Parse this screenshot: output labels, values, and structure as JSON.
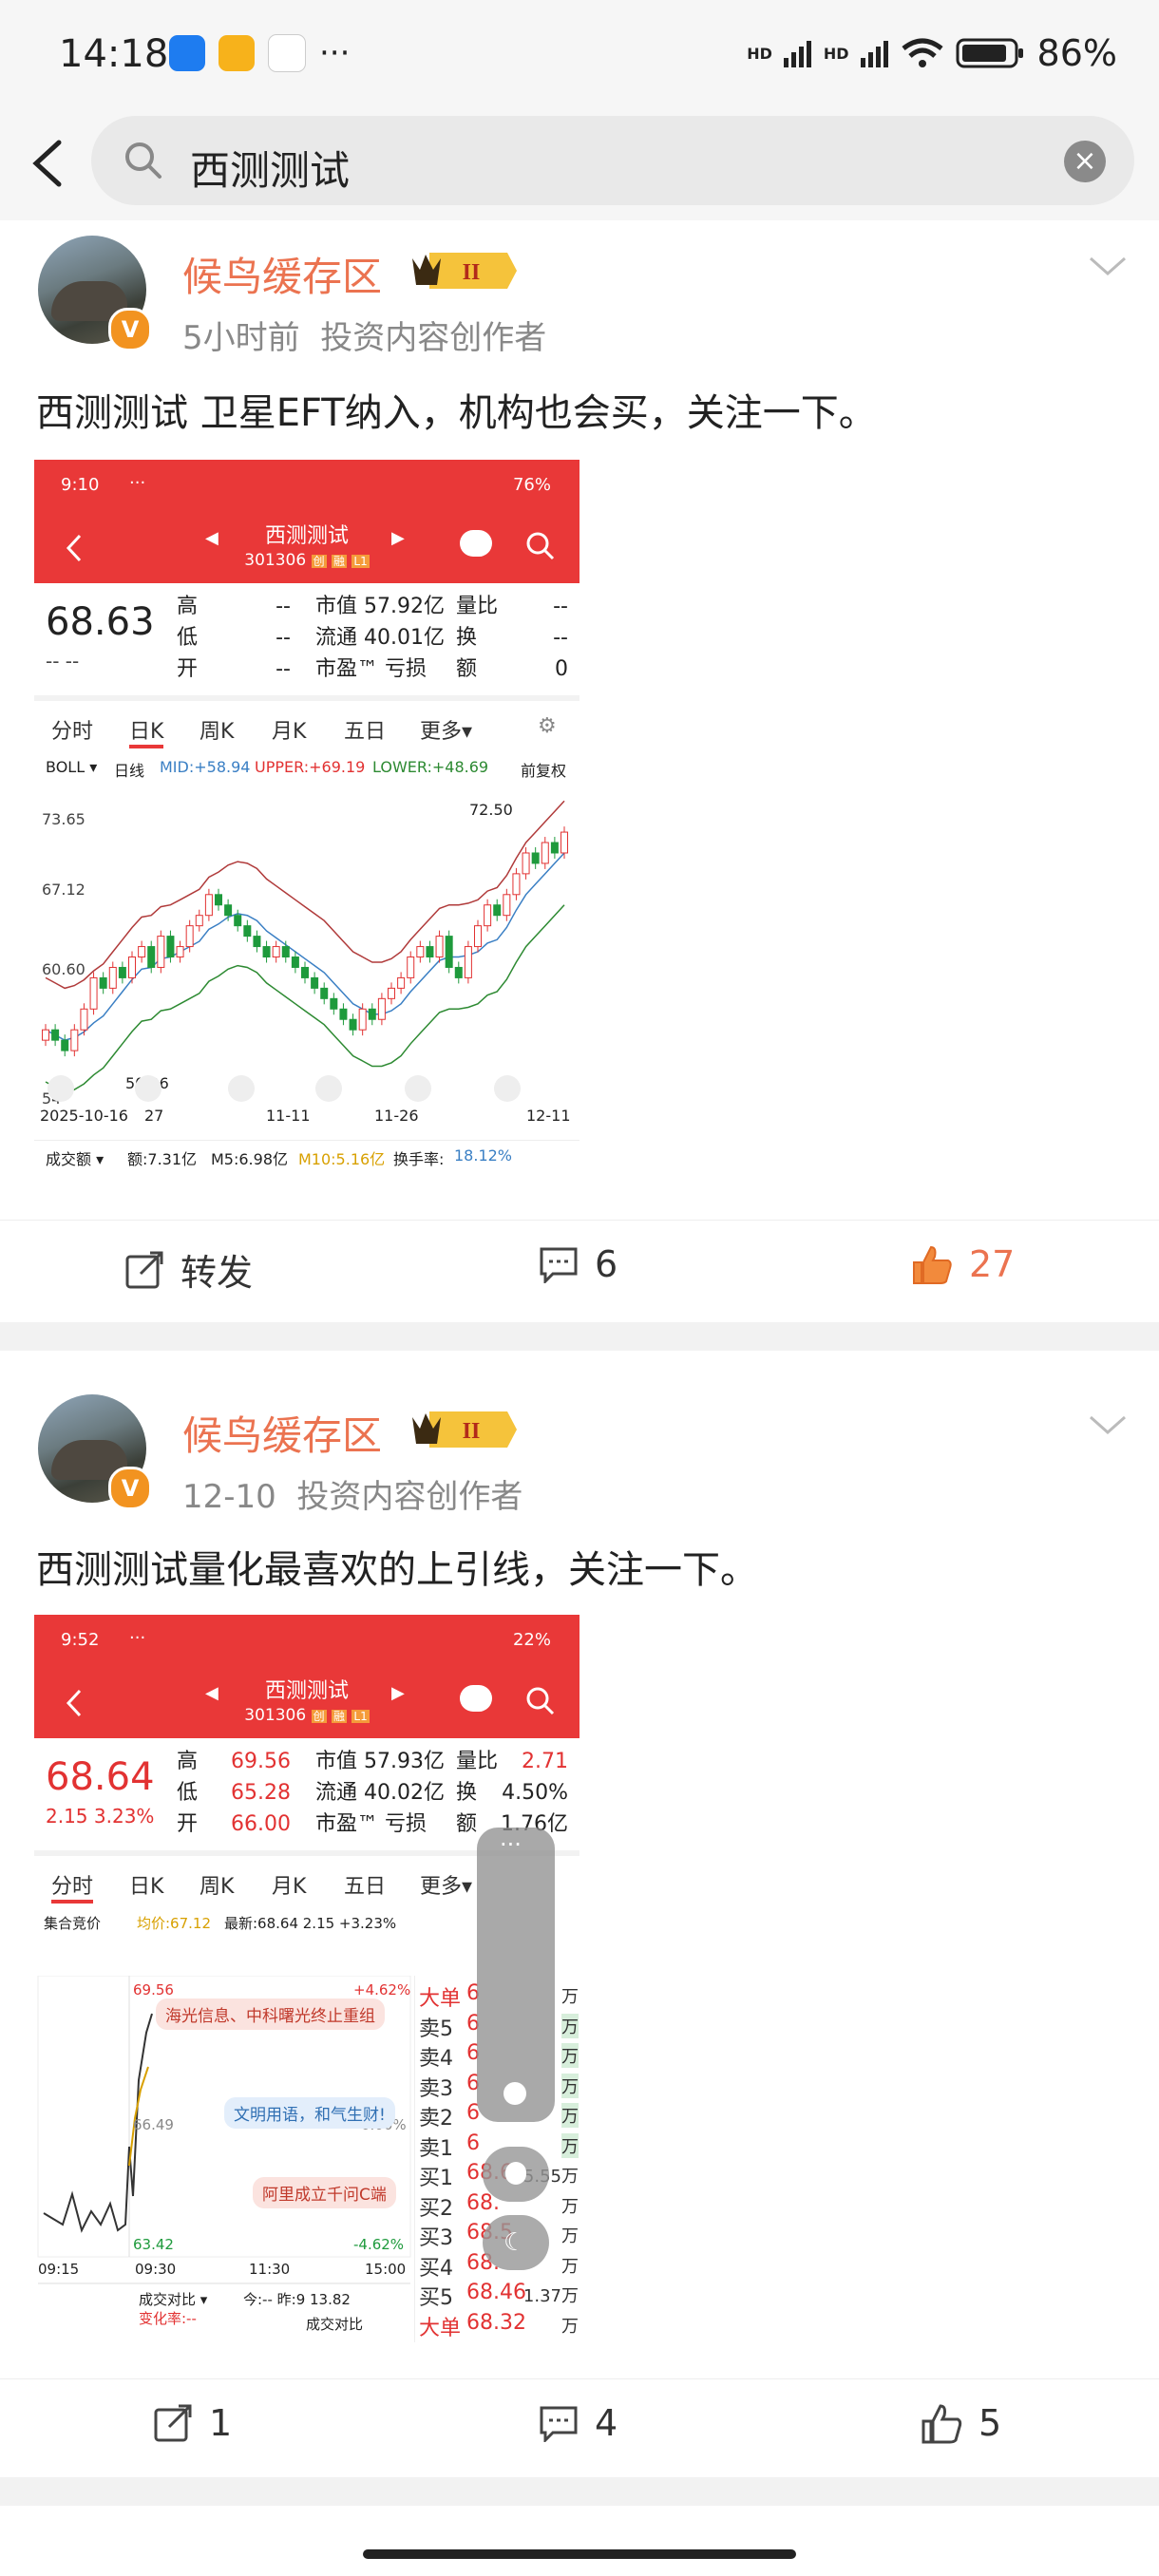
{
  "status_bar": {
    "time": "14:18",
    "dots": "···",
    "network_1": "HD",
    "network_2": "HD",
    "battery": "86%"
  },
  "search": {
    "query": "西测测试"
  },
  "posts": [
    {
      "author": "候鸟缓存区",
      "level": "II",
      "time": "5小时前",
      "role": "投资内容创作者",
      "text": "西测测试 卫星EFT纳入，机构也会买，关注一下。",
      "screenshot": {
        "status_time": "9:10",
        "status_dots": "···",
        "battery": "76%",
        "title": "西测测试",
        "code": "301306",
        "badges": [
          "创",
          "融",
          "L1"
        ],
        "price": "68.63",
        "change": "-- --",
        "quote_rows": [
          {
            "k1": "高",
            "v1": "--",
            "k2": "市值",
            "v2": "57.92亿",
            "k3": "量比",
            "v3": "--"
          },
          {
            "k1": "低",
            "v1": "--",
            "k2": "流通",
            "v2": "40.01亿",
            "k3": "换",
            "v3": "--"
          },
          {
            "k1": "开",
            "v1": "--",
            "k2": "市盈™",
            "v2": "亏损",
            "k3": "额",
            "v3": "0"
          }
        ],
        "tabs": [
          "分时",
          "日K",
          "周K",
          "月K",
          "五日",
          "更多▾"
        ],
        "active_tab": "日K",
        "boll": {
          "name": "BOLL ▾",
          "period": "日线",
          "mid": "MID:+58.94",
          "upper": "UPPER:+69.19",
          "lower": "LOWER:+48.69",
          "adj": "前复权"
        },
        "y_ticks": [
          "73.65",
          "67.12",
          "60.60",
          "54"
        ],
        "peak_label": "72.50",
        "low_label": "50.26",
        "x_ticks": [
          "2025-10-16",
          "27",
          "11-11",
          "11-26",
          "12-11"
        ],
        "volume": {
          "label": "成交额 ▾",
          "v": "额:7.31亿",
          "m5": "M5:6.98亿",
          "m10": "M10:5.16亿",
          "turnover_label": "换手率:",
          "turnover": "18.12%"
        },
        "colors": {
          "header": "#e93838",
          "up": "#e23232",
          "down": "#1e9a3c",
          "upper_band": "#b03a3a",
          "mid_band": "#3a7fc4",
          "lower_band": "#2d8a32"
        }
      },
      "actions": {
        "repost": "转发",
        "comments": "6",
        "likes": "27"
      }
    },
    {
      "author": "候鸟缓存区",
      "level": "II",
      "time": "12-10",
      "role": "投资内容创作者",
      "text": "西测测试量化最喜欢的上引线，关注一下。",
      "screenshot": {
        "status_time": "9:52",
        "status_dots": "···",
        "battery": "22%",
        "title": "西测测试",
        "code": "301306",
        "badges": [
          "创",
          "融",
          "L1"
        ],
        "price": "68.64",
        "change": "2.15  3.23%",
        "quote_rows": [
          {
            "k1": "高",
            "v1": "69.56",
            "k2": "市值",
            "v2": "57.93亿",
            "k3": "量比",
            "v3": "2.71"
          },
          {
            "k1": "低",
            "v1": "65.28",
            "k2": "流通",
            "v2": "40.02亿",
            "k3": "换",
            "v3": "4.50%"
          },
          {
            "k1": "开",
            "v1": "66.00",
            "k2": "市盈™",
            "v2": "亏损",
            "k3": "额",
            "v3": "1.76亿"
          }
        ],
        "tabs": [
          "分时",
          "日K",
          "周K",
          "月K",
          "五日",
          "更多▾"
        ],
        "active_tab": "分时",
        "intraday": {
          "auction": "集合竞价",
          "avg": "均价:67.12",
          "last": "最新:68.64  2.15  +3.23%",
          "y_top": "69.56",
          "y_mid": "66.49",
          "y_bot": "63.42",
          "pct_top": "+4.62%",
          "pct_mid": "0.00%",
          "pct_bot": "-4.62%",
          "news1": "海光信息、中科曙光终止重组",
          "news2": "文明用语，和气生财!",
          "news3": "阿里成立千问C端",
          "x_ticks": [
            "09:15",
            "09:30",
            "11:30",
            "15:00"
          ],
          "footer1": "成交对比 ▾",
          "footer1b": "今:-- 昨:9 13.82",
          "footer2": "变化率:--",
          "footer3": "成交对比"
        },
        "orderbook": [
          {
            "label": "大单",
            "p": "6",
            "v": "万"
          },
          {
            "label": "卖5",
            "p": "6",
            "v": "万"
          },
          {
            "label": "卖4",
            "p": "6",
            "v": "万"
          },
          {
            "label": "卖3",
            "p": "6",
            "v": "万"
          },
          {
            "label": "卖2",
            "p": "6",
            "v": "万"
          },
          {
            "label": "卖1",
            "p": "6",
            "v": "万"
          },
          {
            "label": "买1",
            "p": "68.6",
            "v": "5.55万"
          },
          {
            "label": "买2",
            "p": "68.",
            "v": "万"
          },
          {
            "label": "买3",
            "p": "68.5",
            "v": "万"
          },
          {
            "label": "买4",
            "p": "68.",
            "v": "万"
          },
          {
            "label": "买5",
            "p": "68.46",
            "v": "1.37万"
          },
          {
            "label": "大单",
            "p": "68.32",
            "v": "万"
          }
        ],
        "float_menu": "···"
      },
      "actions": {
        "repost": "1",
        "comments": "4",
        "likes": "5"
      }
    }
  ]
}
